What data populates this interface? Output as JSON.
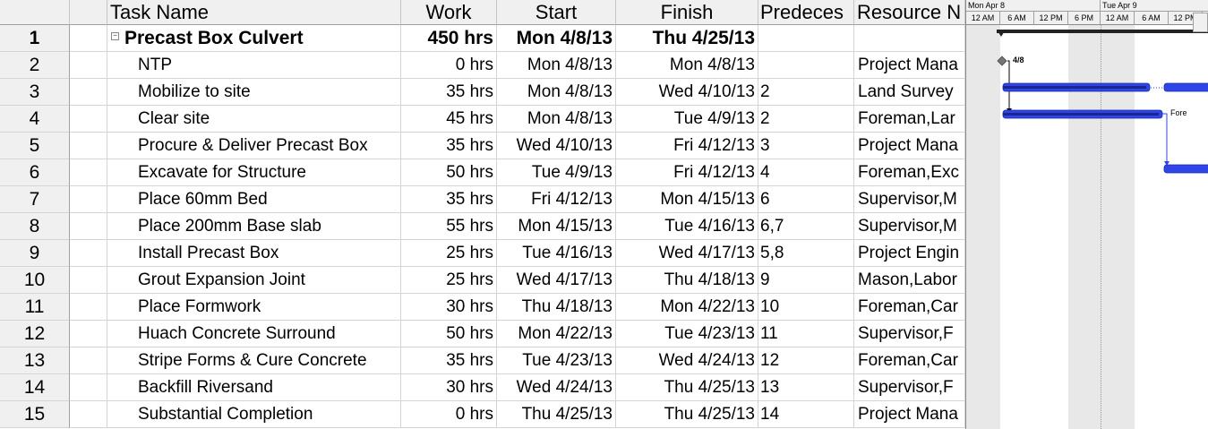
{
  "columns": {
    "info": "i",
    "task_name": "Task Name",
    "work": "Work",
    "start": "Start",
    "finish": "Finish",
    "predecessors": "Predeces",
    "resources": "Resource N"
  },
  "tasks": [
    {
      "id": "1",
      "name": "Precast Box Culvert",
      "work": "450 hrs",
      "start": "Mon 4/8/13",
      "finish": "Thu 4/25/13",
      "pred": "",
      "res": "",
      "summary": true
    },
    {
      "id": "2",
      "name": "NTP",
      "work": "0 hrs",
      "start": "Mon 4/8/13",
      "finish": "Mon 4/8/13",
      "pred": "",
      "res": "Project Mana"
    },
    {
      "id": "3",
      "name": "Mobilize to site",
      "work": "35 hrs",
      "start": "Mon 4/8/13",
      "finish": "Wed 4/10/13",
      "pred": "2",
      "res": "Land Survey"
    },
    {
      "id": "4",
      "name": "Clear site",
      "work": "45 hrs",
      "start": "Mon 4/8/13",
      "finish": "Tue 4/9/13",
      "pred": "2",
      "res": "Foreman,Lar"
    },
    {
      "id": "5",
      "name": "Procure & Deliver Precast Box",
      "work": "35 hrs",
      "start": "Wed 4/10/13",
      "finish": "Fri 4/12/13",
      "pred": "3",
      "res": "Project Mana"
    },
    {
      "id": "6",
      "name": "Excavate for Structure",
      "work": "50 hrs",
      "start": "Tue 4/9/13",
      "finish": "Fri 4/12/13",
      "pred": "4",
      "res": "Foreman,Exc"
    },
    {
      "id": "7",
      "name": "Place 60mm Bed",
      "work": "35 hrs",
      "start": "Fri 4/12/13",
      "finish": "Mon 4/15/13",
      "pred": "6",
      "res": "Supervisor,M"
    },
    {
      "id": "8",
      "name": "Place 200mm Base slab",
      "work": "55 hrs",
      "start": "Mon 4/15/13",
      "finish": "Tue 4/16/13",
      "pred": "6,7",
      "res": "Supervisor,M"
    },
    {
      "id": "9",
      "name": "Install Precast Box",
      "work": "25 hrs",
      "start": "Tue 4/16/13",
      "finish": "Wed 4/17/13",
      "pred": "5,8",
      "res": "Project Engin"
    },
    {
      "id": "10",
      "name": "Grout Expansion Joint",
      "work": "25 hrs",
      "start": "Wed 4/17/13",
      "finish": "Thu 4/18/13",
      "pred": "9",
      "res": "Mason,Labor"
    },
    {
      "id": "11",
      "name": "Place Formwork",
      "work": "30 hrs",
      "start": "Thu 4/18/13",
      "finish": "Mon 4/22/13",
      "pred": "10",
      "res": "Foreman,Car"
    },
    {
      "id": "12",
      "name": "Huach Concrete Surround",
      "work": "50 hrs",
      "start": "Mon 4/22/13",
      "finish": "Tue 4/23/13",
      "pred": "11",
      "res": "Supervisor,F"
    },
    {
      "id": "13",
      "name": "Stripe Forms & Cure Concrete",
      "work": "35 hrs",
      "start": "Tue 4/23/13",
      "finish": "Wed 4/24/13",
      "pred": "12",
      "res": "Foreman,Car"
    },
    {
      "id": "14",
      "name": "Backfill Riversand",
      "work": "30 hrs",
      "start": "Wed 4/24/13",
      "finish": "Thu 4/25/13",
      "pred": "13",
      "res": "Supervisor,F"
    },
    {
      "id": "15",
      "name": "Substantial Completion",
      "work": "0 hrs",
      "start": "Thu 4/25/13",
      "finish": "Thu 4/25/13",
      "pred": "14",
      "res": "Project Mana"
    }
  ],
  "gantt": {
    "days": [
      "Mon Apr 8",
      "Tue Apr 9"
    ],
    "hours": [
      "12 AM",
      "6 AM",
      "12 PM",
      "6 PM",
      "12 AM",
      "6 AM",
      "12 PM"
    ],
    "milestone_label": "4/8",
    "bar_label": "Fore",
    "colors": {
      "bar": "#2f45e8",
      "summary": "#222222",
      "shade": "#e8e8e8"
    }
  }
}
